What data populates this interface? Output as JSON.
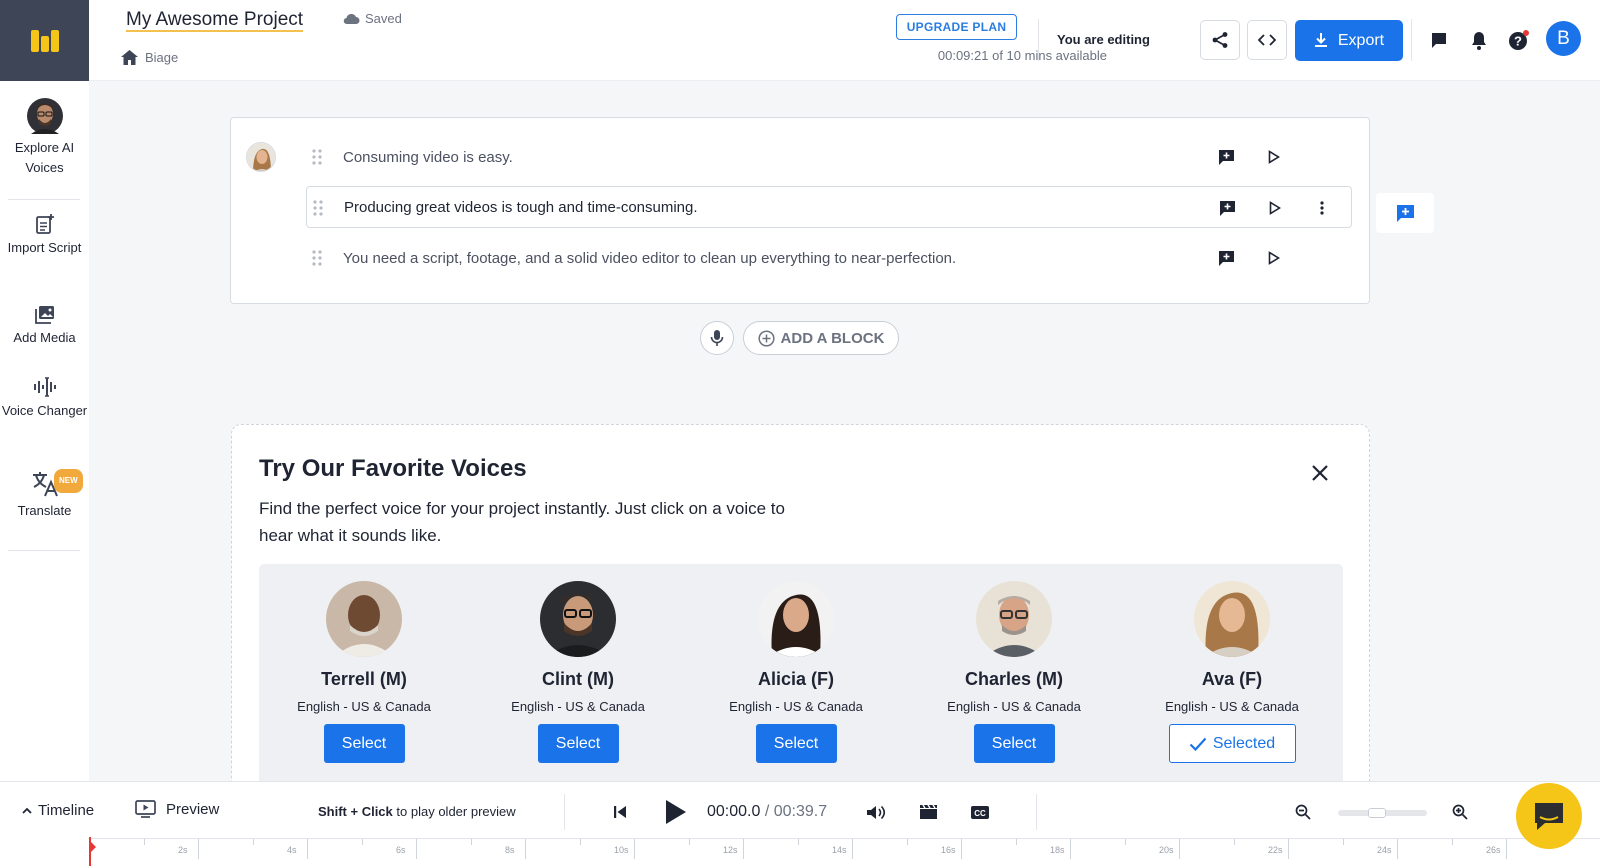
{
  "header": {
    "project_title": "My Awesome Project",
    "save_status": "Saved",
    "breadcrumb": "Biage",
    "upgrade_label": "UPGRADE PLAN",
    "minutes_used": "00:09:21 of 10 mins available",
    "editing_status": "You are editing",
    "export_label": "Export",
    "avatar_initial": "B"
  },
  "sidebar": {
    "items": [
      {
        "label": "Explore AI Voices"
      },
      {
        "label": "Import Script"
      },
      {
        "label": "Add Media"
      },
      {
        "label": "Voice Changer"
      },
      {
        "label": "Translate",
        "badge": "NEW"
      }
    ]
  },
  "script": {
    "lines": [
      {
        "text": "Consuming video is easy."
      },
      {
        "text": "Producing great videos is tough and time-consuming."
      },
      {
        "text": "You need a script, footage, and a solid video editor to clean up everything to near-perfection."
      }
    ],
    "add_block_label": "ADD A BLOCK"
  },
  "voices_panel": {
    "title": "Try Our Favorite Voices",
    "subtitle": "Find the perfect voice for your project instantly. Just click on a voice to hear what it sounds like.",
    "voices": [
      {
        "name": "Terrell (M)",
        "lang": "English - US & Canada",
        "button": "Select"
      },
      {
        "name": "Clint (M)",
        "lang": "English - US & Canada",
        "button": "Select"
      },
      {
        "name": "Alicia (F)",
        "lang": "English - US & Canada",
        "button": "Select"
      },
      {
        "name": "Charles (M)",
        "lang": "English - US & Canada",
        "button": "Select"
      },
      {
        "name": "Ava (F)",
        "lang": "English - US & Canada",
        "button": "Selected"
      }
    ]
  },
  "bottom_bar": {
    "timeline_label": "Timeline",
    "preview_label": "Preview",
    "hint_bold": "Shift + Click",
    "hint_rest": "to play older preview",
    "current_time": "00:00.0",
    "total_time": "/ 00:39.7",
    "ruler_labels": [
      "2s",
      "4s",
      "6s",
      "8s",
      "10s",
      "12s",
      "14s",
      "16s",
      "18s",
      "20s",
      "22s",
      "24s",
      "26s"
    ]
  },
  "colors": {
    "accent": "#1a73e8",
    "logo_bg": "#3d4557",
    "logo_fg": "#f5c518",
    "badge": "#f2a93b",
    "playhead": "#e53935",
    "chat_fab": "#f5c518"
  },
  "icons": [
    "logo-icon",
    "cloud-icon",
    "home-icon",
    "share-icon",
    "embed-icon",
    "download-icon",
    "comment-icon",
    "bell-icon",
    "help-icon",
    "import-icon",
    "media-icon",
    "waveform-icon",
    "translate-icon",
    "grip-icon",
    "add-comment-icon",
    "play-icon",
    "more-icon",
    "mic-icon",
    "plus-circle-icon",
    "close-icon",
    "check-icon",
    "chevron-up-icon",
    "monitor-icon",
    "skip-back-icon",
    "volume-icon",
    "clapper-icon",
    "cc-icon",
    "zoom-out-icon",
    "zoom-in-icon",
    "chat-icon"
  ]
}
